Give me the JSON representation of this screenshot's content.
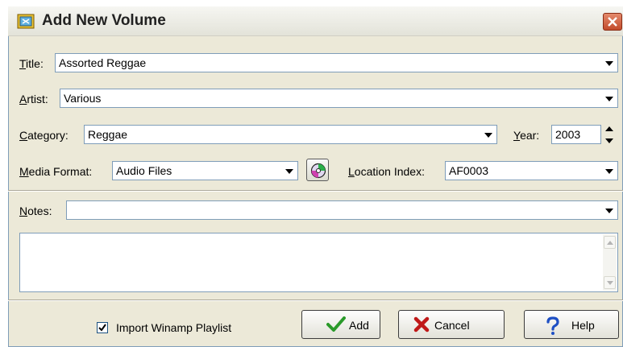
{
  "window": {
    "title": "Add New Volume"
  },
  "fields": {
    "title": {
      "label_u": "T",
      "label_rest": "itle:",
      "value": "Assorted Reggae"
    },
    "artist": {
      "label_u": "A",
      "label_rest": "rtist:",
      "value": "Various"
    },
    "category": {
      "label_u": "C",
      "label_rest": "ategory:",
      "value": "Reggae"
    },
    "year": {
      "label_u": "Y",
      "label_rest": "ear:",
      "value": "2003"
    },
    "media_format": {
      "label_u": "M",
      "label_rest": "edia Format:",
      "value": "Audio Files"
    },
    "location_index": {
      "label_u": "L",
      "label_rest": "ocation Index:",
      "value": "AF0003"
    },
    "notes": {
      "label_u": "N",
      "label_rest": "otes:",
      "value": ""
    }
  },
  "import_playlist": {
    "label": "Import Winamp Playlist",
    "checked": true
  },
  "buttons": {
    "add": "Add",
    "cancel": "Cancel",
    "help": "Help"
  },
  "icons": {
    "app": "book-icon",
    "close": "close-icon",
    "cd": "cd-icon",
    "add": "checkmark-icon",
    "cancel": "x-icon",
    "help": "question-icon"
  },
  "colors": {
    "titlebar": "#ecebe4",
    "close": "#d2603e",
    "check_green": "#2a9a2a",
    "cancel_red": "#c01818",
    "help_blue": "#1e4fc4"
  }
}
